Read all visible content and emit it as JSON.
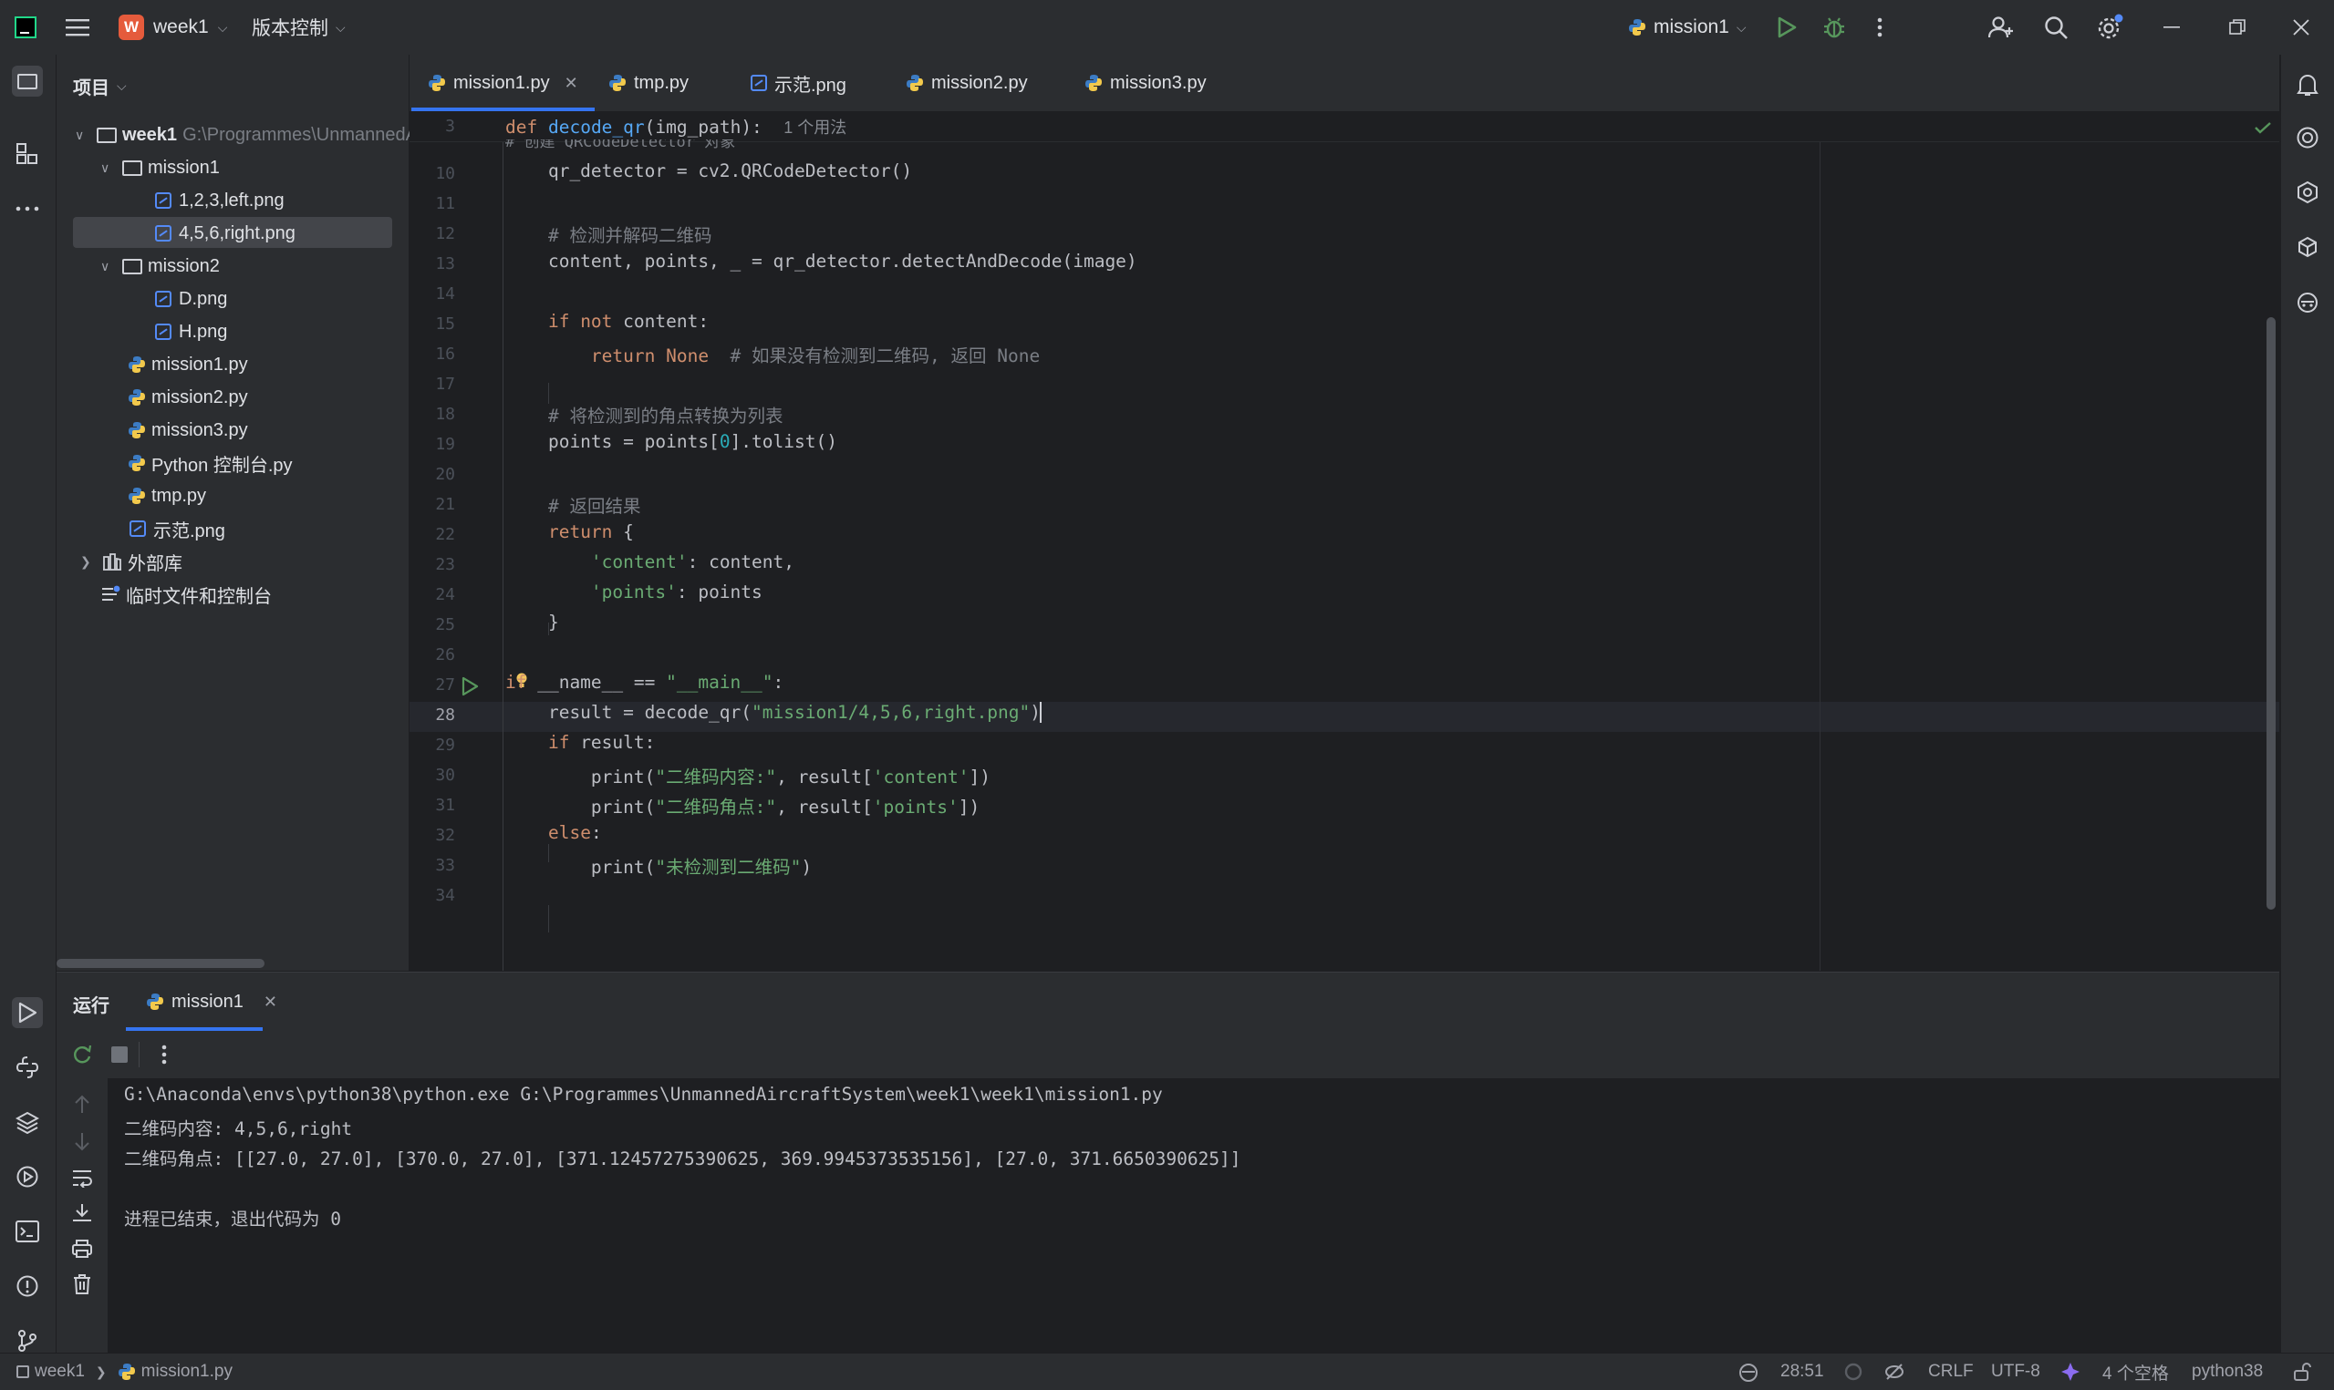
{
  "titlebar": {
    "project_initial": "W",
    "project_name": "week1",
    "vcs_menu": "版本控制",
    "run_config": "mission1"
  },
  "project_panel": {
    "title": "项目",
    "root": {
      "name": "week1",
      "path": "G:\\Programmes\\UnmannedA"
    },
    "items": [
      {
        "label": "mission1",
        "kind": "folder"
      },
      {
        "label": "1,2,3,left.png",
        "kind": "image"
      },
      {
        "label": "4,5,6,right.png",
        "kind": "image"
      },
      {
        "label": "mission2",
        "kind": "folder"
      },
      {
        "label": "D.png",
        "kind": "image"
      },
      {
        "label": "H.png",
        "kind": "image"
      },
      {
        "label": "mission1.py",
        "kind": "python"
      },
      {
        "label": "mission2.py",
        "kind": "python"
      },
      {
        "label": "mission3.py",
        "kind": "python"
      },
      {
        "label": "Python 控制台.py",
        "kind": "python"
      },
      {
        "label": "tmp.py",
        "kind": "python"
      },
      {
        "label": "示范.png",
        "kind": "image"
      },
      {
        "label": "外部库",
        "kind": "library"
      },
      {
        "label": "临时文件和控制台",
        "kind": "scratch"
      }
    ]
  },
  "tabs": [
    {
      "label": "mission1.py",
      "kind": "python",
      "active": true
    },
    {
      "label": "tmp.py",
      "kind": "python"
    },
    {
      "label": "示范.png",
      "kind": "image"
    },
    {
      "label": "mission2.py",
      "kind": "python"
    },
    {
      "label": "mission3.py",
      "kind": "python"
    }
  ],
  "editor": {
    "sticky_line_number": "3",
    "sticky_def": "def",
    "sticky_fn": "decode_qr",
    "sticky_args": "(img_path):",
    "sticky_hint": "1 个用法",
    "clipped_comment": "# 创建 QRCodeDetector 对象",
    "line_numbers": [
      "10",
      "11",
      "12",
      "13",
      "14",
      "15",
      "16",
      "17",
      "18",
      "19",
      "20",
      "21",
      "22",
      "23",
      "24",
      "25",
      "26",
      "27",
      "28",
      "29",
      "30",
      "31",
      "32",
      "33",
      "34"
    ],
    "current_line": "28"
  },
  "run_panel": {
    "title": "运行",
    "tab": "mission1",
    "output": [
      "G:\\Anaconda\\envs\\python38\\python.exe G:\\Programmes\\UnmannedAircraftSystem\\week1\\week1\\mission1.py",
      "二维码内容: 4,5,6,right",
      "二维码角点: [[27.0, 27.0], [370.0, 27.0], [371.12457275390625, 369.9945373535156], [27.0, 371.6650390625]]",
      "",
      "进程已结束，退出代码为 0"
    ]
  },
  "statusbar": {
    "crumb_project": "week1",
    "crumb_file": "mission1.py",
    "position": "28:51",
    "line_sep": "CRLF",
    "encoding": "UTF-8",
    "indent": "4 个空格",
    "interpreter": "python38"
  }
}
